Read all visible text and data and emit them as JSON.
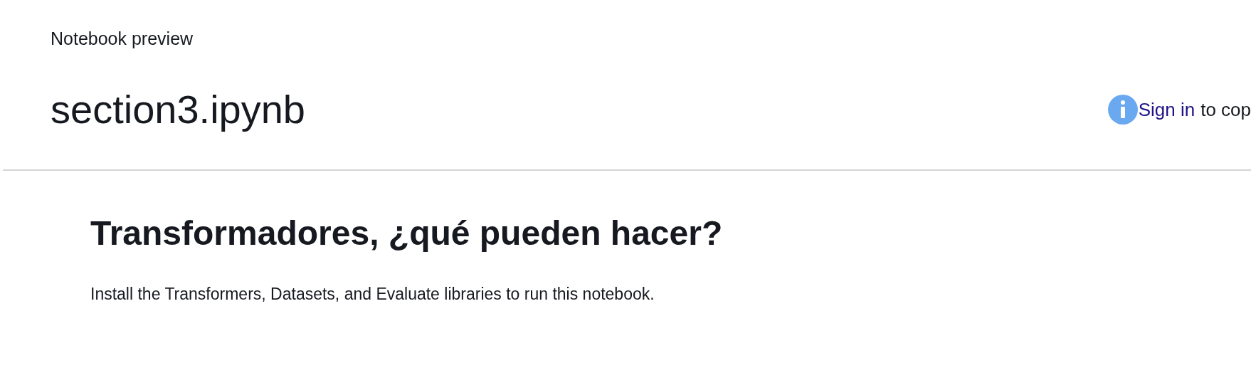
{
  "header": {
    "label": "Notebook preview",
    "title": "section3.ipynb"
  },
  "notice": {
    "link": "Sign in",
    "text": "to cop"
  },
  "notebook": {
    "heading": "Transformadores, ¿qué pueden hacer?",
    "paragraph": "Install the Transformers, Datasets, and Evaluate libraries to run this notebook."
  }
}
